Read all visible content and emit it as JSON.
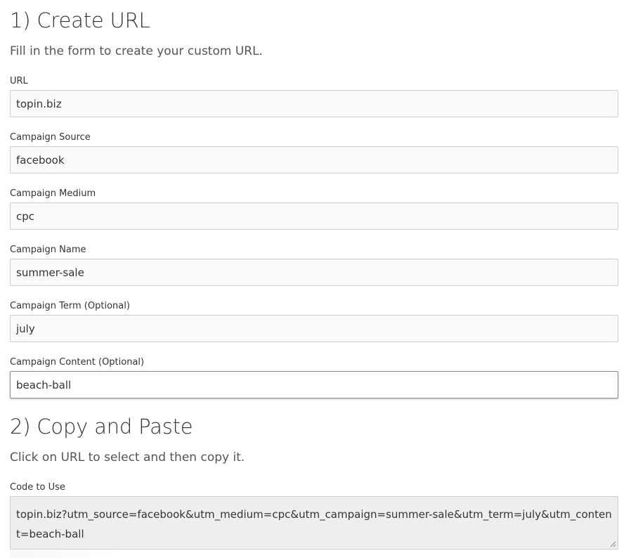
{
  "section1": {
    "heading": "1) Create URL",
    "intro": "Fill in the form to create your custom URL."
  },
  "fields": [
    {
      "label": "URL",
      "value": "topin.biz"
    },
    {
      "label": "Campaign Source",
      "value": "facebook"
    },
    {
      "label": "Campaign Medium",
      "value": "cpc"
    },
    {
      "label": "Campaign Name",
      "value": "summer-sale"
    },
    {
      "label": "Campaign Term (Optional)",
      "value": "july"
    },
    {
      "label": "Campaign Content (Optional)",
      "value": "beach-ball"
    }
  ],
  "section2": {
    "heading": "2) Copy and Paste",
    "intro": "Click on URL to select and then copy it.",
    "code_label": "Code to Use",
    "code_value": "topin.biz?utm_source=facebook&utm_medium=cpc&utm_campaign=summer-sale&utm_term=july&utm_content=beach-ball"
  }
}
